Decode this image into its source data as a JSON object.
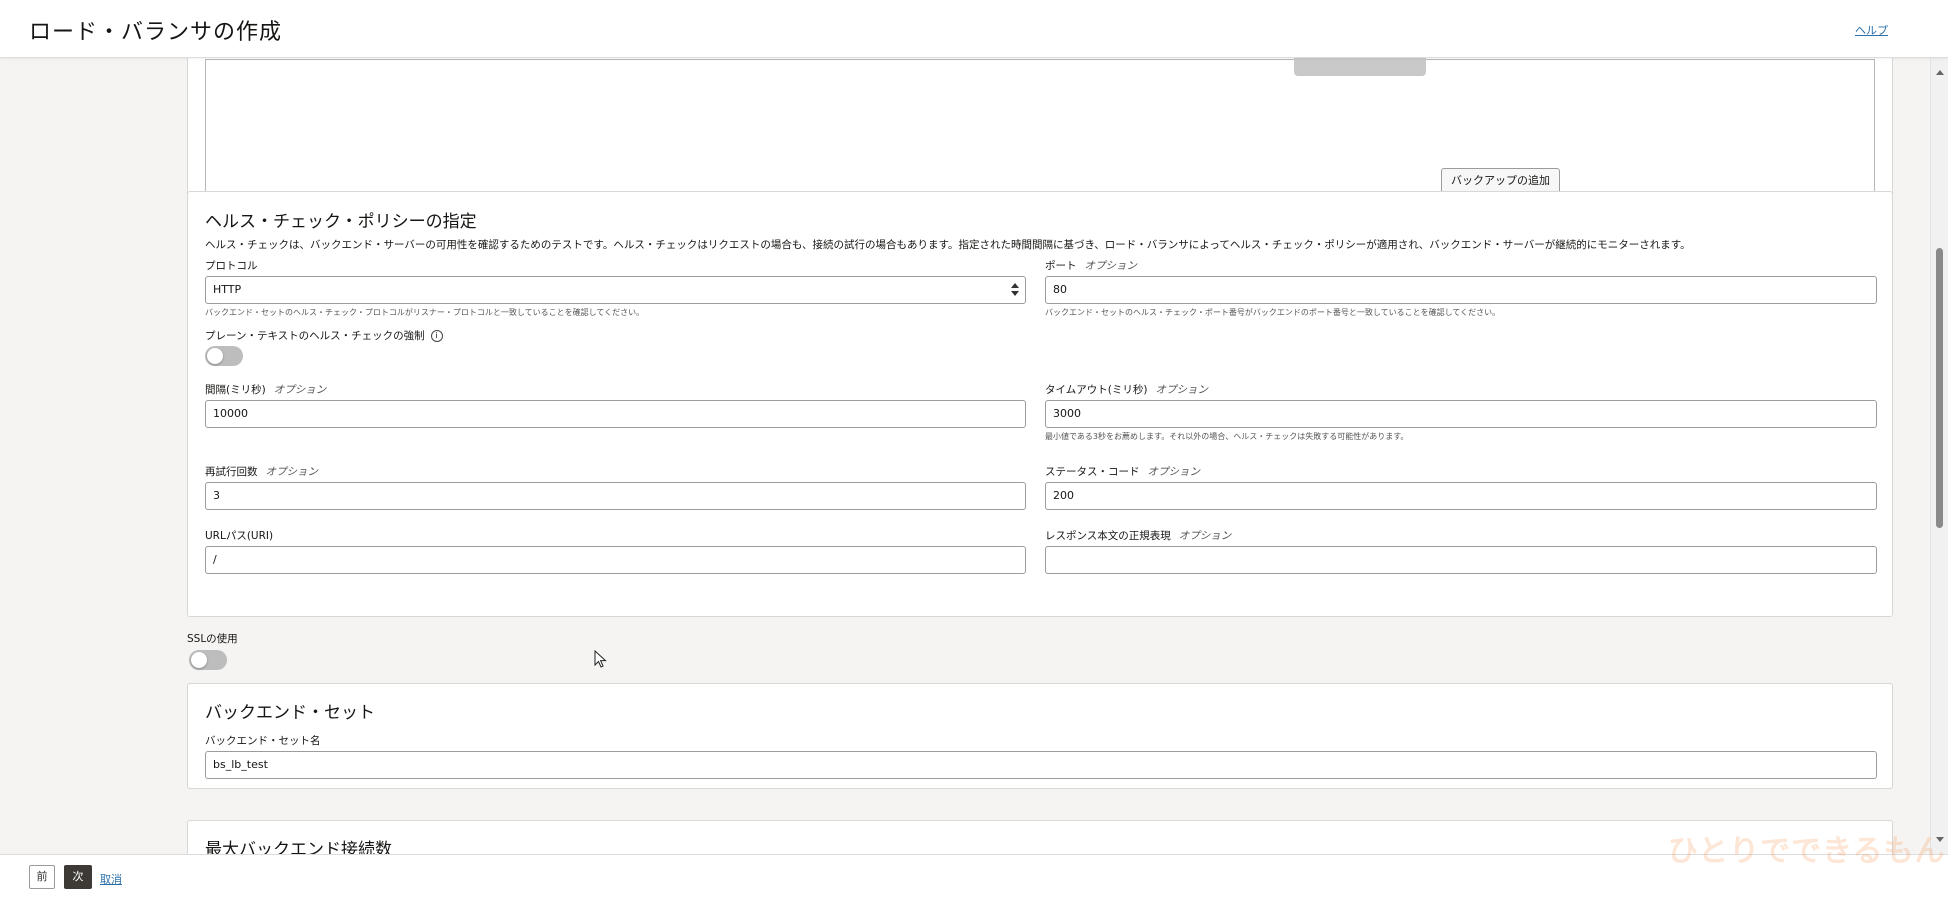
{
  "header": {
    "title": "ロード・バランサの作成",
    "help": "ヘルプ"
  },
  "backup": {
    "add_backup_label": "バックアップの追加"
  },
  "health_check": {
    "title": "ヘルス・チェック・ポリシーの指定",
    "description": "ヘルス・チェックは、バックエンド・サーバーの可用性を確認するためのテストです。ヘルス・チェックはリクエストの場合も、接続の試行の場合もあります。指定された時間間隔に基づき、ロード・バランサによってヘルス・チェック・ポリシーが適用され、バックエンド・サーバーが継続的にモニターされます。",
    "protocol": {
      "label": "プロトコル",
      "value": "HTTP",
      "hint": "バックエンド・セットのヘルス・チェック・プロトコルがリスナー・プロトコルと一致していることを確認してください。"
    },
    "port": {
      "label": "ポート",
      "optional": "オプション",
      "value": "80",
      "hint": "バックエンド・セットのヘルス・チェック・ポート番号がバックエンドのポート番号と一致していることを確認してください。"
    },
    "plaintext": {
      "label": "プレーン・テキストのヘルス・チェックの強制",
      "info": "i",
      "enabled": false
    },
    "interval": {
      "label": "間隔(ミリ秒)",
      "optional": "オプション",
      "value": "10000"
    },
    "timeout": {
      "label": "タイムアウト(ミリ秒)",
      "optional": "オプション",
      "value": "3000",
      "hint": "最小値である3秒をお薦めします。それ以外の場合、ヘルス・チェックは失敗する可能性があります。"
    },
    "retries": {
      "label": "再試行回数",
      "optional": "オプション",
      "value": "3"
    },
    "status_code": {
      "label": "ステータス・コード",
      "optional": "オプション",
      "value": "200"
    },
    "url_path": {
      "label": "URLパス(URI)",
      "value": "/"
    },
    "response_regex": {
      "label": "レスポンス本文の正規表現",
      "optional": "オプション",
      "value": ""
    }
  },
  "ssl": {
    "label": "SSLの使用",
    "enabled": false
  },
  "backend_set": {
    "title": "バックエンド・セット",
    "name_label": "バックエンド・セット名",
    "name_value": "bs_lb_test"
  },
  "max_connections": {
    "title": "最大バックエンド接続数"
  },
  "footer": {
    "prev": "前",
    "next": "次",
    "cancel": "取消"
  },
  "watermark": "ひとりでできるもん"
}
